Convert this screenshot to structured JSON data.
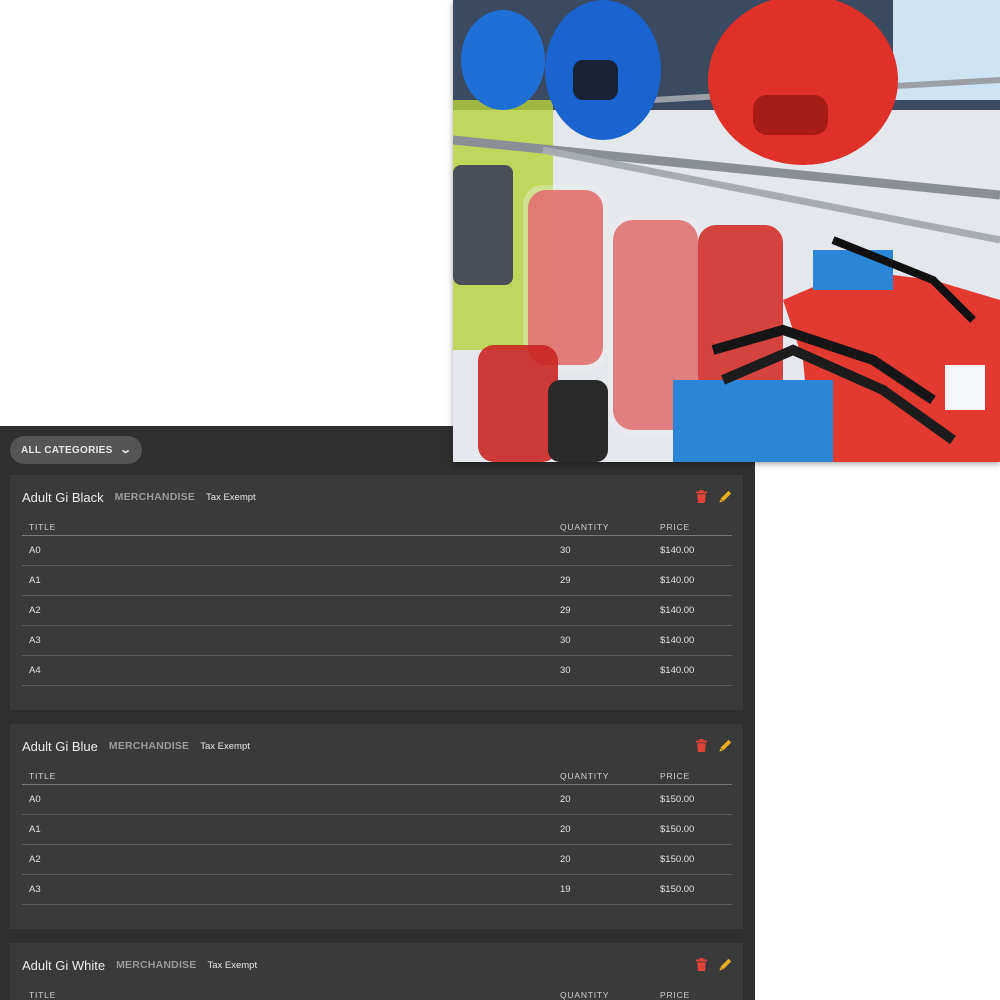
{
  "filter": {
    "label": "ALL CATEGORIES"
  },
  "products": [
    {
      "name": "Adult Gi Black",
      "category": "MERCHANDISE",
      "tax": "Tax Exempt",
      "columns": {
        "title": "TITLE",
        "quantity": "QUANTITY",
        "price": "PRICE"
      },
      "rows": [
        {
          "title": "A0",
          "quantity": "30",
          "price": "$140.00"
        },
        {
          "title": "A1",
          "quantity": "29",
          "price": "$140.00"
        },
        {
          "title": "A2",
          "quantity": "29",
          "price": "$140.00"
        },
        {
          "title": "A3",
          "quantity": "30",
          "price": "$140.00"
        },
        {
          "title": "A4",
          "quantity": "30",
          "price": "$140.00"
        }
      ]
    },
    {
      "name": "Adult Gi Blue",
      "category": "MERCHANDISE",
      "tax": "Tax Exempt",
      "columns": {
        "title": "TITLE",
        "quantity": "QUANTITY",
        "price": "PRICE"
      },
      "rows": [
        {
          "title": "A0",
          "quantity": "20",
          "price": "$150.00"
        },
        {
          "title": "A1",
          "quantity": "20",
          "price": "$150.00"
        },
        {
          "title": "A2",
          "quantity": "20",
          "price": "$150.00"
        },
        {
          "title": "A3",
          "quantity": "19",
          "price": "$150.00"
        }
      ]
    },
    {
      "name": "Adult Gi White",
      "category": "MERCHANDISE",
      "tax": "Tax Exempt",
      "columns": {
        "title": "TITLE",
        "quantity": "QUANTITY",
        "price": "PRICE"
      },
      "rows": []
    }
  ],
  "colors": {
    "panel": "#2f2f2f",
    "card": "#3a3a3a",
    "delete": "#e0433a",
    "edit": "#e8b020"
  },
  "icons": {
    "delete": "trash-icon",
    "edit": "pencil-icon",
    "dropdown": "chevron-down-icon"
  }
}
